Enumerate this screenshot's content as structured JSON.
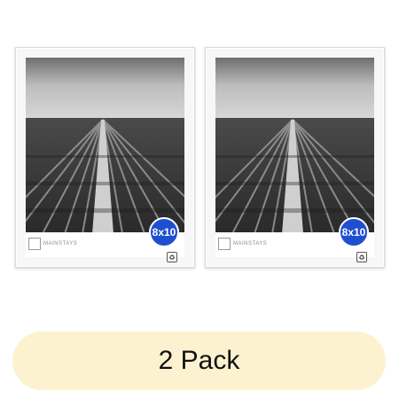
{
  "product": {
    "frame_size_label": "8x10",
    "brand_label": "MAINSTAYS",
    "recycle_icon": "recycle-icon"
  },
  "pack": {
    "label": "2 Pack",
    "background": "#fdf2cf"
  },
  "colors": {
    "badge": "#1f4fd1"
  }
}
